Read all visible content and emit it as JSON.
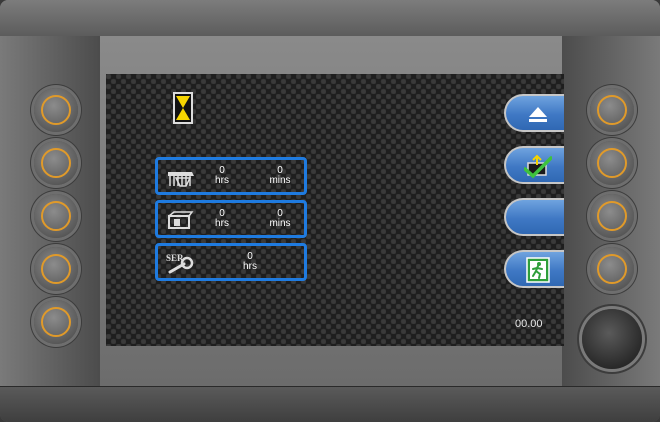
{
  "status": {
    "clock": "00.00"
  },
  "counters": [
    {
      "icon": "machine-hours-icon",
      "hours_value": "0",
      "hours_unit": "hrs",
      "mins_value": "0",
      "mins_unit": "mins"
    },
    {
      "icon": "engine-hours-icon",
      "hours_value": "0",
      "hours_unit": "hrs",
      "mins_value": "0",
      "mins_unit": "mins"
    },
    {
      "icon": "service-wrench-icon",
      "icon_text": "SER",
      "hours_value": "0",
      "hours_unit": "hrs"
    }
  ],
  "soft_buttons": [
    {
      "icon": "eject-icon"
    },
    {
      "icon": "confirm-upload-icon"
    },
    {
      "icon": ""
    },
    {
      "icon": "exit-icon"
    }
  ],
  "colors": {
    "box_border": "#1f7be0",
    "hw_ring": "#e09a2a",
    "soft_button": "#3f78c4",
    "hourglass": "#f5d400",
    "check": "#3ec23e",
    "exit_green": "#2e9e3a"
  }
}
